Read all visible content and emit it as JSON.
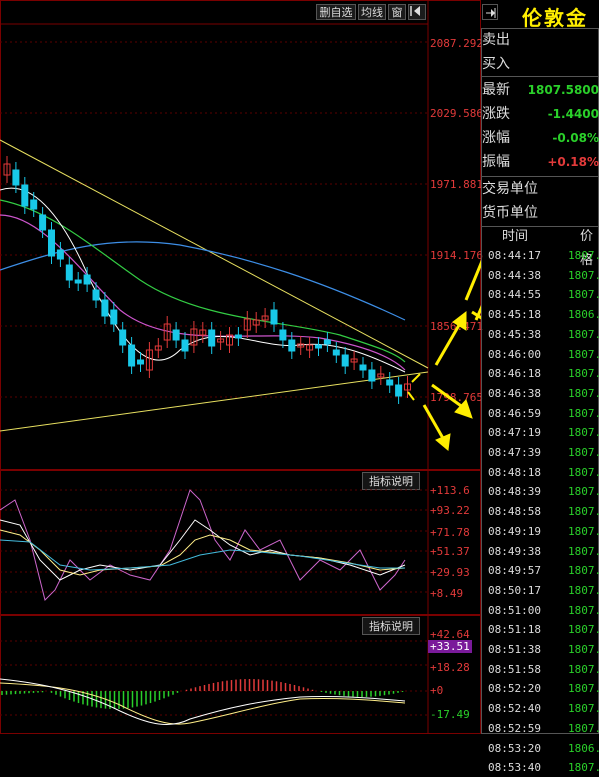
{
  "toolbar": {
    "delete_watch_label": "删自选",
    "avg_line_label": "均线",
    "window_label": "窗"
  },
  "price_axis": [
    "2087.292",
    "2029.586",
    "1971.881",
    "1914.176",
    "1856.471",
    "1798.765"
  ],
  "macd1": {
    "explain_label": "指标说明",
    "axis": [
      "+113.6",
      "+93.22",
      "+71.78",
      "+51.37",
      "+29.93",
      "+8.49"
    ]
  },
  "macd2": {
    "explain_label": "指标说明",
    "axis": [
      "+42.64",
      "+33.51",
      "+18.28",
      "+0",
      "-17.49"
    ],
    "current_value": "+33.51"
  },
  "quote": {
    "title": "伦敦金",
    "sell_label": "卖出",
    "buy_label": "买入",
    "last_label": "最新",
    "last_value": "1807.5800",
    "change_label": "涨跌",
    "change_value": "-1.4400",
    "change_pct_label": "涨幅",
    "change_pct_value": "-0.08%",
    "amplitude_label": "振幅",
    "amplitude_value": "+0.18%",
    "trade_unit_label": "交易单位",
    "currency_unit_label": "货币单位",
    "time_header": "时间",
    "price_header": "价格"
  },
  "ticks": [
    {
      "time": "08:44:17",
      "price": "1807."
    },
    {
      "time": "08:44:38",
      "price": "1807."
    },
    {
      "time": "08:44:55",
      "price": "1807."
    },
    {
      "time": "08:45:18",
      "price": "1806."
    },
    {
      "time": "08:45:38",
      "price": "1807."
    },
    {
      "time": "08:46:00",
      "price": "1807."
    },
    {
      "time": "08:46:18",
      "price": "1807."
    },
    {
      "time": "08:46:38",
      "price": "1807."
    },
    {
      "time": "08:46:59",
      "price": "1807."
    },
    {
      "time": "08:47:19",
      "price": "1807."
    },
    {
      "time": "08:47:39",
      "price": "1807."
    },
    {
      "time": "08:48:18",
      "price": "1807."
    },
    {
      "time": "08:48:39",
      "price": "1807."
    },
    {
      "time": "08:48:58",
      "price": "1807."
    },
    {
      "time": "08:49:19",
      "price": "1807."
    },
    {
      "time": "08:49:38",
      "price": "1807."
    },
    {
      "time": "08:49:57",
      "price": "1807."
    },
    {
      "time": "08:50:17",
      "price": "1807."
    },
    {
      "time": "08:51:00",
      "price": "1807."
    },
    {
      "time": "08:51:18",
      "price": "1807."
    },
    {
      "time": "08:51:38",
      "price": "1807."
    },
    {
      "time": "08:51:58",
      "price": "1807."
    },
    {
      "time": "08:52:20",
      "price": "1807."
    },
    {
      "time": "08:52:40",
      "price": "1807."
    },
    {
      "time": "08:52:59",
      "price": "1807."
    },
    {
      "time": "08:53:20",
      "price": "1806."
    },
    {
      "time": "08:53:40",
      "price": "1807."
    }
  ],
  "colors": {
    "up": "#e23a3a",
    "down": "#18c8e8",
    "accent_yellow": "#ffee00",
    "green": "#2ad02a",
    "border": "#7a0000"
  }
}
